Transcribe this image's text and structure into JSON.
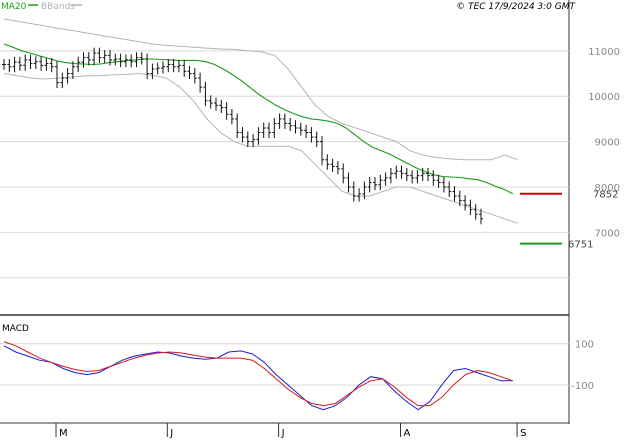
{
  "header": {
    "indicator": "MA20",
    "bands": "BBands",
    "copyright": "© TEC 17/9/2024 3:0 GMT"
  },
  "macd_label": "MACD",
  "levels": {
    "resistance": {
      "value": 7852,
      "label": "7852",
      "color": "#cc0000"
    },
    "support": {
      "value": 6751,
      "label": "6751",
      "color": "#1a9e1a"
    }
  },
  "colors": {
    "ma": "#1a9e1a",
    "bands": "#b4b4b4",
    "price": "#111111",
    "macd": "#1c1cd0",
    "signal": "#d01c1c",
    "grid": "#d8d8d8",
    "axis": "#333333"
  },
  "chart_data": [
    {
      "type": "ohlc",
      "title": "",
      "y_ticks": [
        {
          "value": 11000,
          "label": "11000"
        },
        {
          "value": 10000,
          "label": "10000"
        },
        {
          "value": 9000,
          "label": "9000"
        },
        {
          "value": 8000,
          "label": "8000"
        },
        {
          "value": 7000,
          "label": "7000"
        }
      ],
      "ylim": [
        5400,
        11900
      ],
      "x_months": [
        {
          "label": "M",
          "index": 10
        },
        {
          "label": "J",
          "index": 31
        },
        {
          "label": "J",
          "index": 52
        },
        {
          "label": "A",
          "index": 75
        },
        {
          "label": "S",
          "index": 97
        }
      ],
      "close": [
        10700,
        10650,
        10750,
        10680,
        10800,
        10720,
        10760,
        10680,
        10720,
        10650,
        10300,
        10400,
        10500,
        10650,
        10750,
        10850,
        10800,
        10950,
        10850,
        10900,
        10800,
        10820,
        10760,
        10800,
        10760,
        10850,
        10820,
        10500,
        10600,
        10620,
        10650,
        10700,
        10650,
        10680,
        10550,
        10500,
        10400,
        10200,
        9900,
        9850,
        9800,
        9750,
        9600,
        9500,
        9200,
        9100,
        9000,
        9050,
        9200,
        9300,
        9200,
        9400,
        9500,
        9400,
        9350,
        9300,
        9250,
        9200,
        9100,
        9000,
        8600,
        8500,
        8450,
        8400,
        8200,
        8000,
        7800,
        7850,
        8000,
        8100,
        8050,
        8150,
        8200,
        8300,
        8350,
        8300,
        8250,
        8200,
        8250,
        8300,
        8250,
        8150,
        8100,
        8000,
        7900,
        7800,
        7700,
        7600,
        7500,
        7400,
        7300
      ],
      "ma20": [
        11150,
        11080,
        11000,
        10950,
        10890,
        10840,
        10780,
        10740,
        10720,
        10710,
        10700,
        10710,
        10740,
        10760,
        10790,
        10800,
        10820,
        10820,
        10810,
        10800,
        10790,
        10790,
        10790,
        10760,
        10700,
        10600,
        10480,
        10350,
        10200,
        10050,
        9920,
        9800,
        9700,
        9620,
        9550,
        9500,
        9480,
        9450,
        9400,
        9300,
        9150,
        9000,
        8880,
        8800,
        8720,
        8620,
        8520,
        8420,
        8340,
        8270,
        8230,
        8220,
        8210,
        8180,
        8160,
        8100,
        8020,
        7950,
        7850
      ],
      "bb_upper": [
        11700,
        11650,
        11600,
        11550,
        11500,
        11450,
        11400,
        11350,
        11300,
        11250,
        11200,
        11150,
        11120,
        11100,
        11080,
        11060,
        11040,
        11030,
        11000,
        10980,
        10900,
        10600,
        10200,
        9800,
        9550,
        9400,
        9300,
        9200,
        9100,
        9000,
        8800,
        8700,
        8650,
        8620,
        8600,
        8600,
        8600,
        8700,
        8600
      ],
      "bb_lower": [
        10500,
        10450,
        10400,
        10380,
        10400,
        10420,
        10450,
        10450,
        10470,
        10480,
        10500,
        10460,
        10400,
        10200,
        9900,
        9500,
        9200,
        9000,
        8900,
        8900,
        8900,
        8900,
        8800,
        8500,
        8200,
        7900,
        7800,
        7800,
        7900,
        8000,
        8000,
        7900,
        7800,
        7700,
        7600,
        7500,
        7400,
        7300,
        7200
      ]
    },
    {
      "type": "line",
      "title": "",
      "y_ticks": [
        {
          "value": 100,
          "label": "100"
        },
        {
          "value": -100,
          "label": "-100"
        }
      ],
      "ylim": [
        -270,
        215
      ],
      "series": [
        {
          "name": "",
          "values": [
            90,
            60,
            40,
            20,
            10,
            -20,
            -40,
            -50,
            -40,
            -10,
            20,
            40,
            50,
            60,
            55,
            40,
            30,
            25,
            30,
            60,
            65,
            50,
            10,
            -50,
            -100,
            -150,
            -200,
            -220,
            -200,
            -160,
            -100,
            -60,
            -70,
            -130,
            -180,
            -220,
            -180,
            -100,
            -30,
            -20,
            -40,
            -60,
            -80,
            -80
          ]
        },
        {
          "name": "",
          "values": [
            110,
            90,
            60,
            30,
            10,
            -10,
            -25,
            -35,
            -30,
            -10,
            10,
            30,
            45,
            55,
            60,
            55,
            45,
            35,
            30,
            30,
            30,
            20,
            -20,
            -70,
            -120,
            -160,
            -190,
            -200,
            -190,
            -150,
            -110,
            -80,
            -70,
            -110,
            -160,
            -200,
            -200,
            -160,
            -100,
            -50,
            -30,
            -40,
            -60,
            -80
          ]
        }
      ]
    }
  ]
}
